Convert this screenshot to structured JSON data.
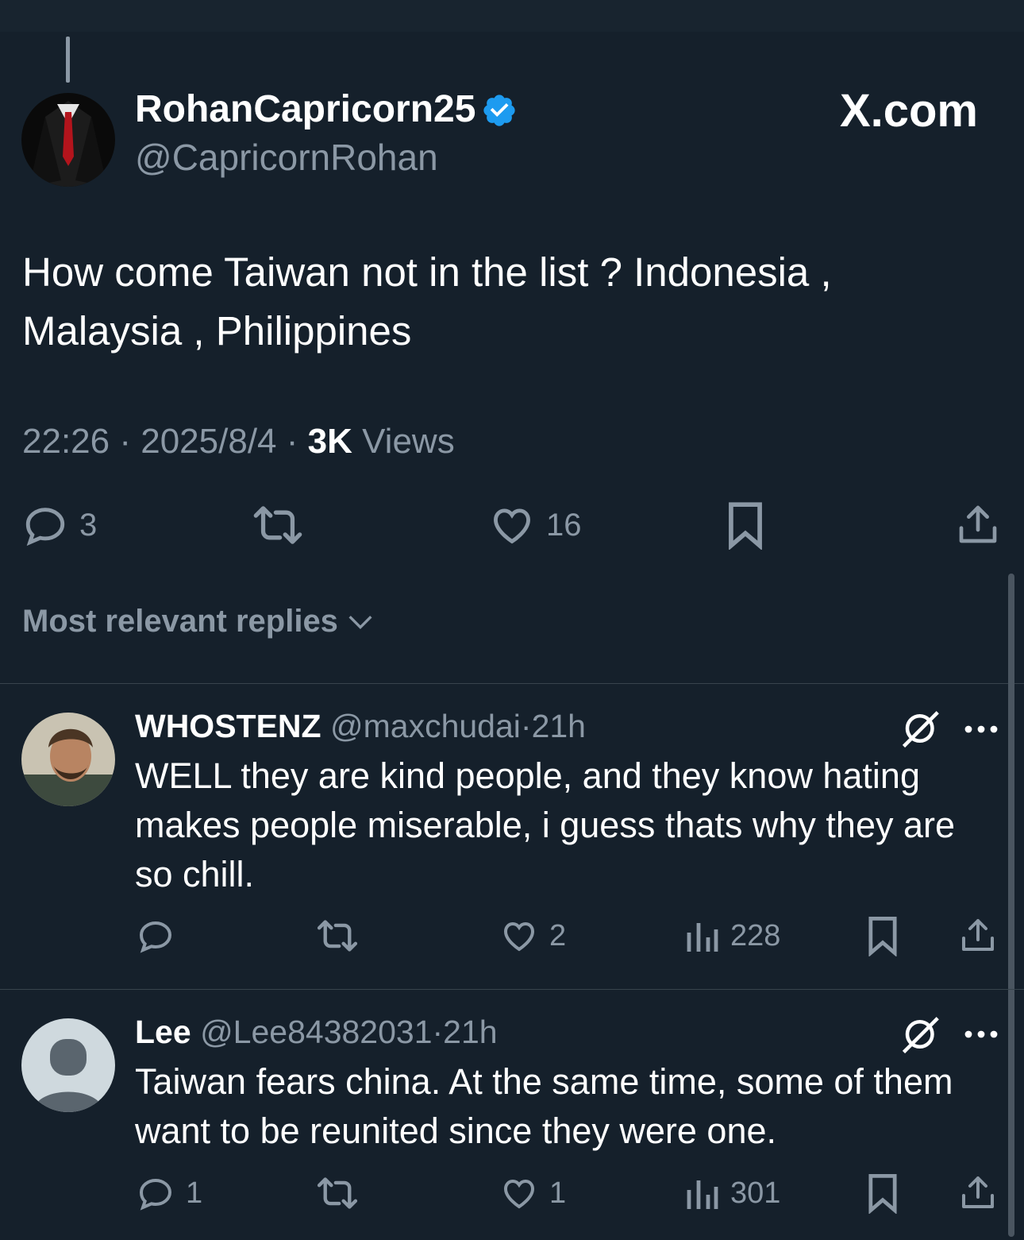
{
  "post": {
    "display_name": "RohanCapricorn25",
    "handle": "@CapricornRohan",
    "verified": true,
    "watermark": "X.com",
    "text": "How come Taiwan not in the list ? Indonesia , Malaysia , Philippines",
    "time": "22:26",
    "date": "2025/8/4",
    "views_count": "3K",
    "views_label": "Views",
    "separator": "·",
    "actions": {
      "replies": "3",
      "reposts": "",
      "likes": "16"
    }
  },
  "replies_sort_label": "Most relevant replies",
  "replies": [
    {
      "name": "WHOSTENZ",
      "handle": "@maxchudai",
      "age": "21h",
      "text": "WELL they are kind people, and they know hating makes people miserable, i guess thats why they are so chill.",
      "actions": {
        "replies": "",
        "reposts": "",
        "likes": "2",
        "views": "228"
      }
    },
    {
      "name": "Lee",
      "handle": "@Lee84382031",
      "age": "21h",
      "text": "Taiwan fears china. At the same time, some of them want to be reunited since they were one.",
      "actions": {
        "replies": "1",
        "reposts": "",
        "likes": "1",
        "views": "301"
      }
    }
  ],
  "colors": {
    "background": "#15202b",
    "text": "#ffffff",
    "muted": "#8b98a5",
    "verified": "#1d9bf0",
    "divider": "#38444d"
  }
}
